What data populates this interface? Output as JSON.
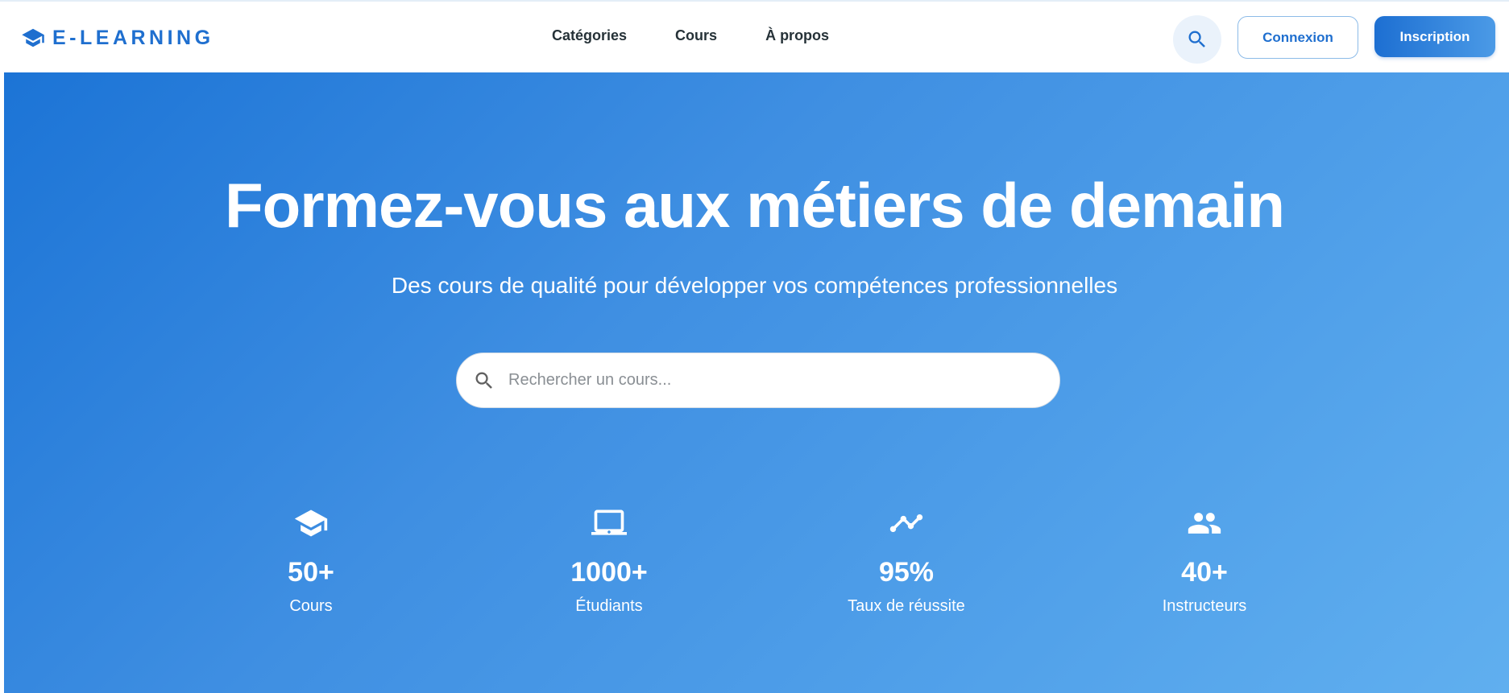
{
  "brand": {
    "name": "E-LEARNING",
    "icon": "graduation-cap-icon",
    "color": "#1f6fcf"
  },
  "nav": {
    "links": [
      {
        "label": "Catégories"
      },
      {
        "label": "Cours"
      },
      {
        "label": "À propos"
      }
    ],
    "search_icon": "search-icon",
    "login_label": "Connexion",
    "signup_label": "Inscription"
  },
  "hero": {
    "title": "Formez-vous aux métiers de demain",
    "subtitle": "Des cours de qualité pour développer vos compétences professionnelles",
    "search": {
      "placeholder": "Rechercher un cours...",
      "value": ""
    },
    "gradient": [
      "#1c74d6",
      "#60afef"
    ]
  },
  "stats": [
    {
      "icon": "graduation-cap-icon",
      "value": "50+",
      "label": "Cours"
    },
    {
      "icon": "laptop-icon",
      "value": "1000+",
      "label": "Étudiants"
    },
    {
      "icon": "trending-line-icon",
      "value": "95%",
      "label": "Taux de réussite"
    },
    {
      "icon": "people-icon",
      "value": "40+",
      "label": "Instructeurs"
    }
  ]
}
